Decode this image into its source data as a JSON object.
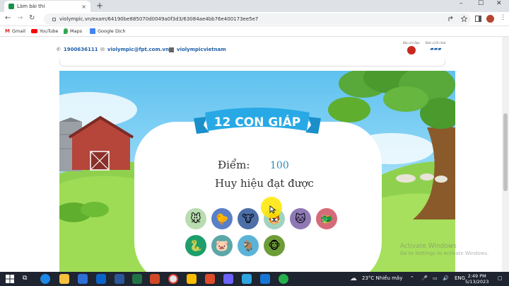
{
  "browser": {
    "tab_title": "Làm bài thi",
    "tab_close": "×",
    "new_tab": "+",
    "url": "violympic.vn/exam/64190be885070d0049a0f3d3/63084ae4bb76e400173ee5e7",
    "nav": {
      "back": "←",
      "forward": "→",
      "reload": "↻"
    },
    "window": {
      "minimize": "–",
      "maximize": "☐",
      "close": "✕"
    },
    "bookmarks": [
      "Gmail",
      "YouTube",
      "Maps",
      "Google Dịch"
    ]
  },
  "site": {
    "phone": "1900636111",
    "email": "violympic@fpt.com.vn",
    "facebook": "violympicvietnam",
    "logo1": "Ban chỉ đạo",
    "logo2": "Đơn vị tổ chức"
  },
  "game": {
    "title": "12 CON GIÁP",
    "score_label": "Điểm:",
    "score_value": "100",
    "badge_label": "Huy hiệu đạt được",
    "badges_row1": [
      {
        "name": "rat",
        "color": "#b9dcb0",
        "emoji": "🐭"
      },
      {
        "name": "chick",
        "color": "#5a7fc7",
        "emoji": "🐤"
      },
      {
        "name": "ox",
        "color": "#4c6fa8",
        "emoji": "🐮"
      },
      {
        "name": "tiger",
        "color": "#9fd3c0",
        "emoji": "🐯"
      },
      {
        "name": "cat",
        "color": "#8e79b5",
        "emoji": "🐱"
      },
      {
        "name": "dragon",
        "color": "#d76a78",
        "emoji": "🐲"
      }
    ],
    "badges_row2": [
      {
        "name": "snake",
        "color": "#1d9e6a",
        "emoji": "🐍"
      },
      {
        "name": "pig",
        "color": "#5ba7a8",
        "emoji": "🐷"
      },
      {
        "name": "goat",
        "color": "#5bb3d8",
        "emoji": "🐐"
      },
      {
        "name": "monkey",
        "color": "#6d9d37",
        "emoji": "🐵"
      }
    ],
    "watermark_line1": "Activate Windows",
    "watermark_line2": "Go to Settings to activate Windows."
  },
  "taskbar": {
    "weather": "23°C  Nhiều mây",
    "lang": "ENG",
    "time": "2:49 PM",
    "date": "5/13/2023"
  }
}
